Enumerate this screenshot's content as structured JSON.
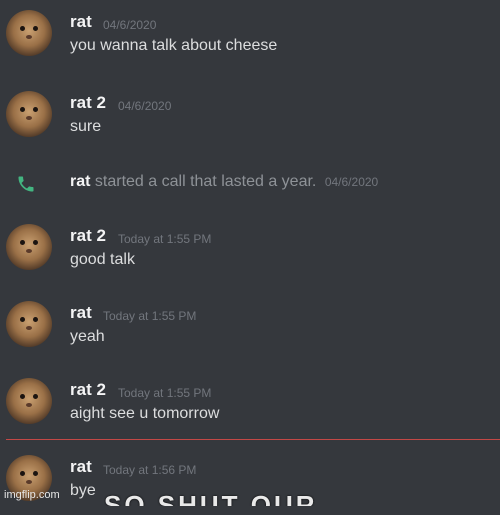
{
  "messages": [
    {
      "user": "rat",
      "time": "04/6/2020",
      "text": "you wanna talk about cheese"
    },
    {
      "user": "rat 2",
      "time": "04/6/2020",
      "text": "sure"
    },
    {
      "user": "rat 2",
      "time": "Today at 1:55 PM",
      "text": "good talk"
    },
    {
      "user": "rat",
      "time": "Today at 1:55 PM",
      "text": "yeah"
    },
    {
      "user": "rat 2",
      "time": "Today at 1:55 PM",
      "text": "aight see u tomorrow"
    },
    {
      "user": "rat",
      "time": "Today at 1:56 PM",
      "text": "bye"
    }
  ],
  "call": {
    "user": "rat",
    "text": "started a call that lasted a year.",
    "time": "04/6/2020",
    "icon": "phone-icon",
    "icon_color": "#43b581"
  },
  "divider_color": "#c34846",
  "overlay_text": "SO SHUT OUR",
  "watermark": "imgflip.com"
}
